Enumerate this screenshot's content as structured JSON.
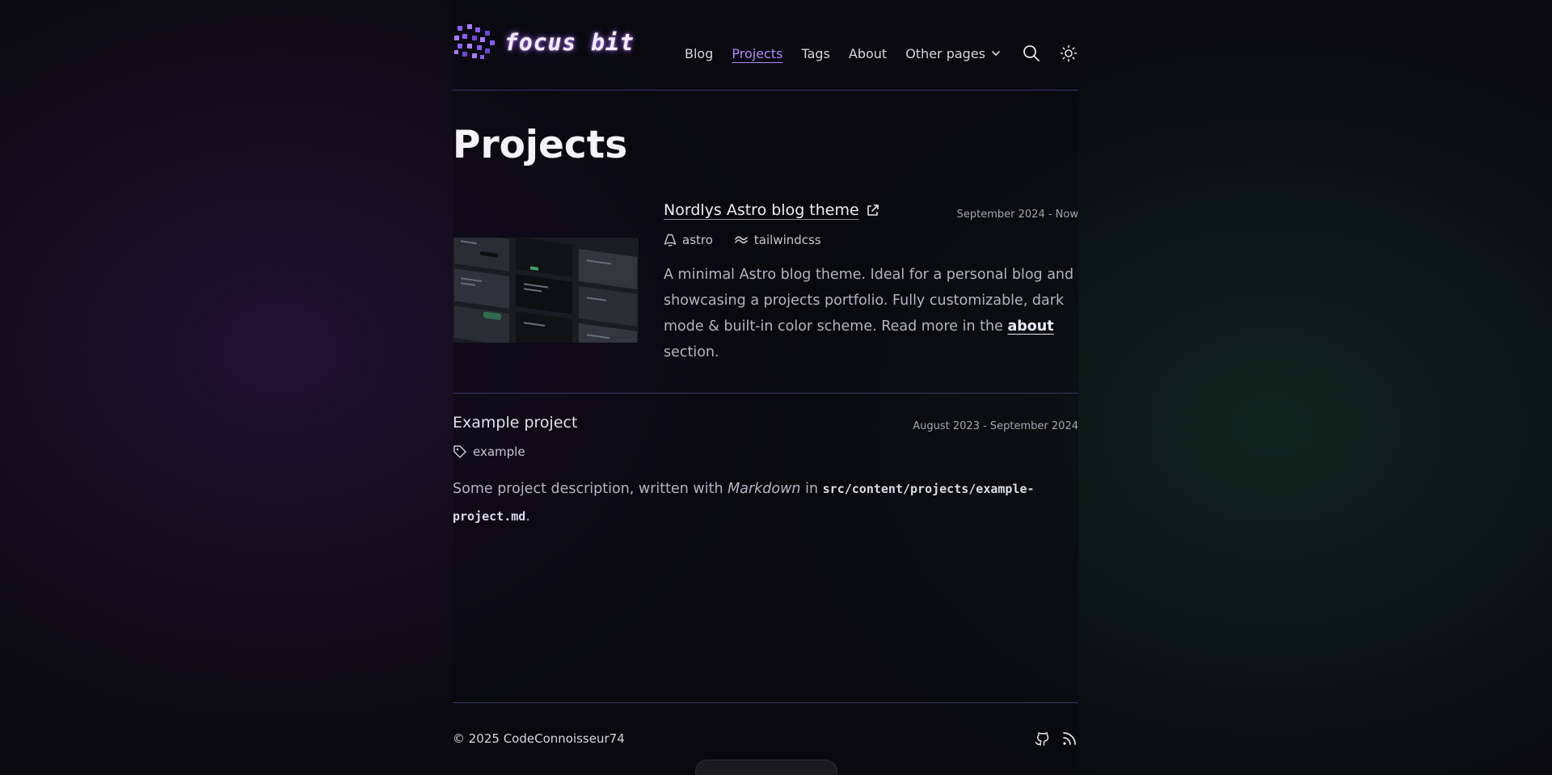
{
  "brand": {
    "name": "focus bit"
  },
  "nav": {
    "items": [
      {
        "label": "Blog"
      },
      {
        "label": "Projects"
      },
      {
        "label": "Tags"
      },
      {
        "label": "About"
      }
    ],
    "dropdown_label": "Other pages",
    "search_icon": "search-icon",
    "theme_icon": "sun-icon"
  },
  "page": {
    "title": "Projects"
  },
  "projects": [
    {
      "title": "Nordlys Astro blog theme",
      "date": "September 2024 - Now",
      "tags": [
        "astro",
        "tailwindcss"
      ],
      "description": "A minimal Astro blog theme. Ideal for a personal blog and showcasing a projects portfolio. Fully customizable, dark mode & built-in color scheme. Read more in the",
      "link_text": "about",
      "description_end": "section."
    },
    {
      "title": "Example project",
      "date": "August 2023 - September 2024",
      "tags": [
        "example"
      ],
      "desc_1": "Some project description, written with",
      "desc_em": "Markdown",
      "desc_2": "in",
      "desc_code_a": "src/content/projects/example-",
      "desc_code_b": "project.md",
      "desc_end": "."
    }
  ],
  "footer": {
    "copyright": "© 2025 CodeConnoisseur74",
    "icons": [
      "github-icon",
      "rss-icon"
    ]
  },
  "colors": {
    "accent": "#b28bff",
    "rule": "#3d3470",
    "background": "#0a0a0f"
  }
}
